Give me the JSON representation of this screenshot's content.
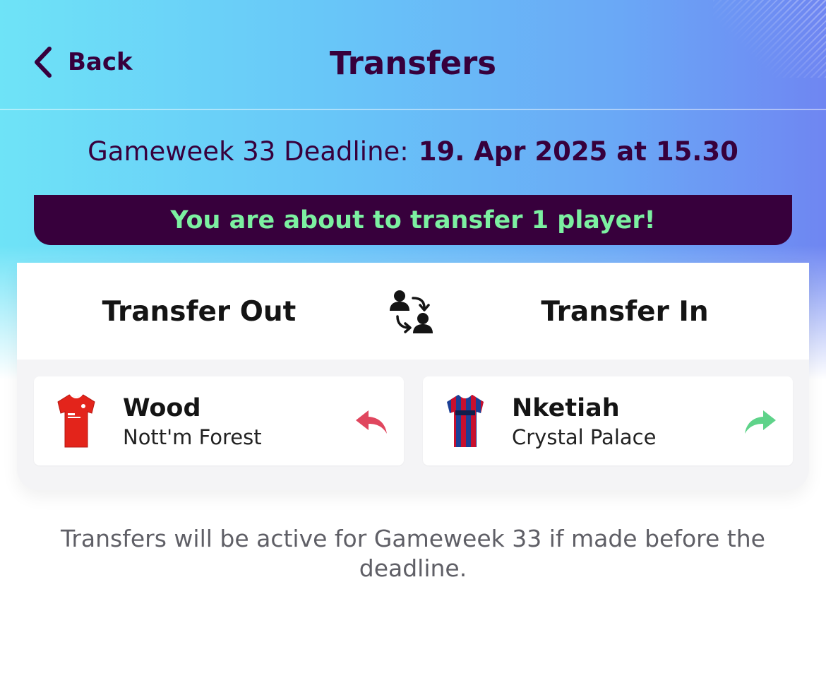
{
  "header": {
    "back_label": "Back",
    "title": "Transfers"
  },
  "deadline": {
    "label": "Gameweek 33 Deadline:",
    "value": "19. Apr 2025 at 15.30"
  },
  "banner": {
    "text": "You are about to transfer 1 player!"
  },
  "columns": {
    "out_title": "Transfer Out",
    "in_title": "Transfer In"
  },
  "transfer_out": {
    "name": "Wood",
    "team": "Nott'm Forest",
    "shirt_color": "#e3241b",
    "arrow_color": "#e0465e"
  },
  "transfer_in": {
    "name": "Nketiah",
    "team": "Crystal Palace",
    "shirt_colors": [
      "#1b3f95",
      "#c8102e"
    ],
    "arrow_color": "#5fd38a"
  },
  "footnote": "Transfers will be active for Gameweek 33 if made before the deadline.",
  "icons": [
    "chevron-left-icon",
    "player-swap-icon",
    "reply-arrow-icon",
    "forward-arrow-icon",
    "shirt-icon"
  ],
  "colors": {
    "brand_purple": "#37003c",
    "banner_text": "#7cf0a1"
  }
}
